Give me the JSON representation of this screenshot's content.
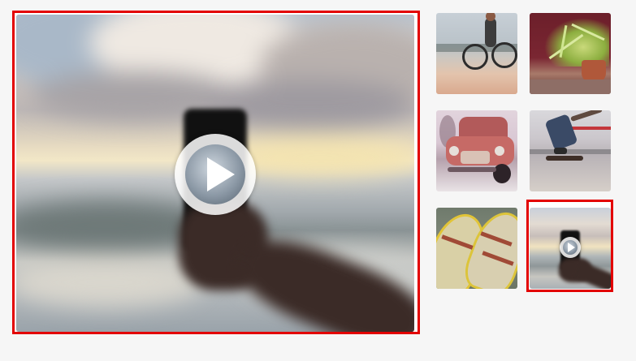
{
  "gallery": {
    "accent_color": "#e30000",
    "main_video": {
      "icon": "play-icon"
    },
    "thumbnails": [
      {
        "subject": "cyclist"
      },
      {
        "subject": "potted-plant"
      },
      {
        "subject": "old-truck"
      },
      {
        "subject": "skateboarder"
      },
      {
        "subject": "rowboats"
      },
      {
        "subject": "phone-video",
        "selected": true,
        "icon": "play-icon"
      }
    ]
  }
}
